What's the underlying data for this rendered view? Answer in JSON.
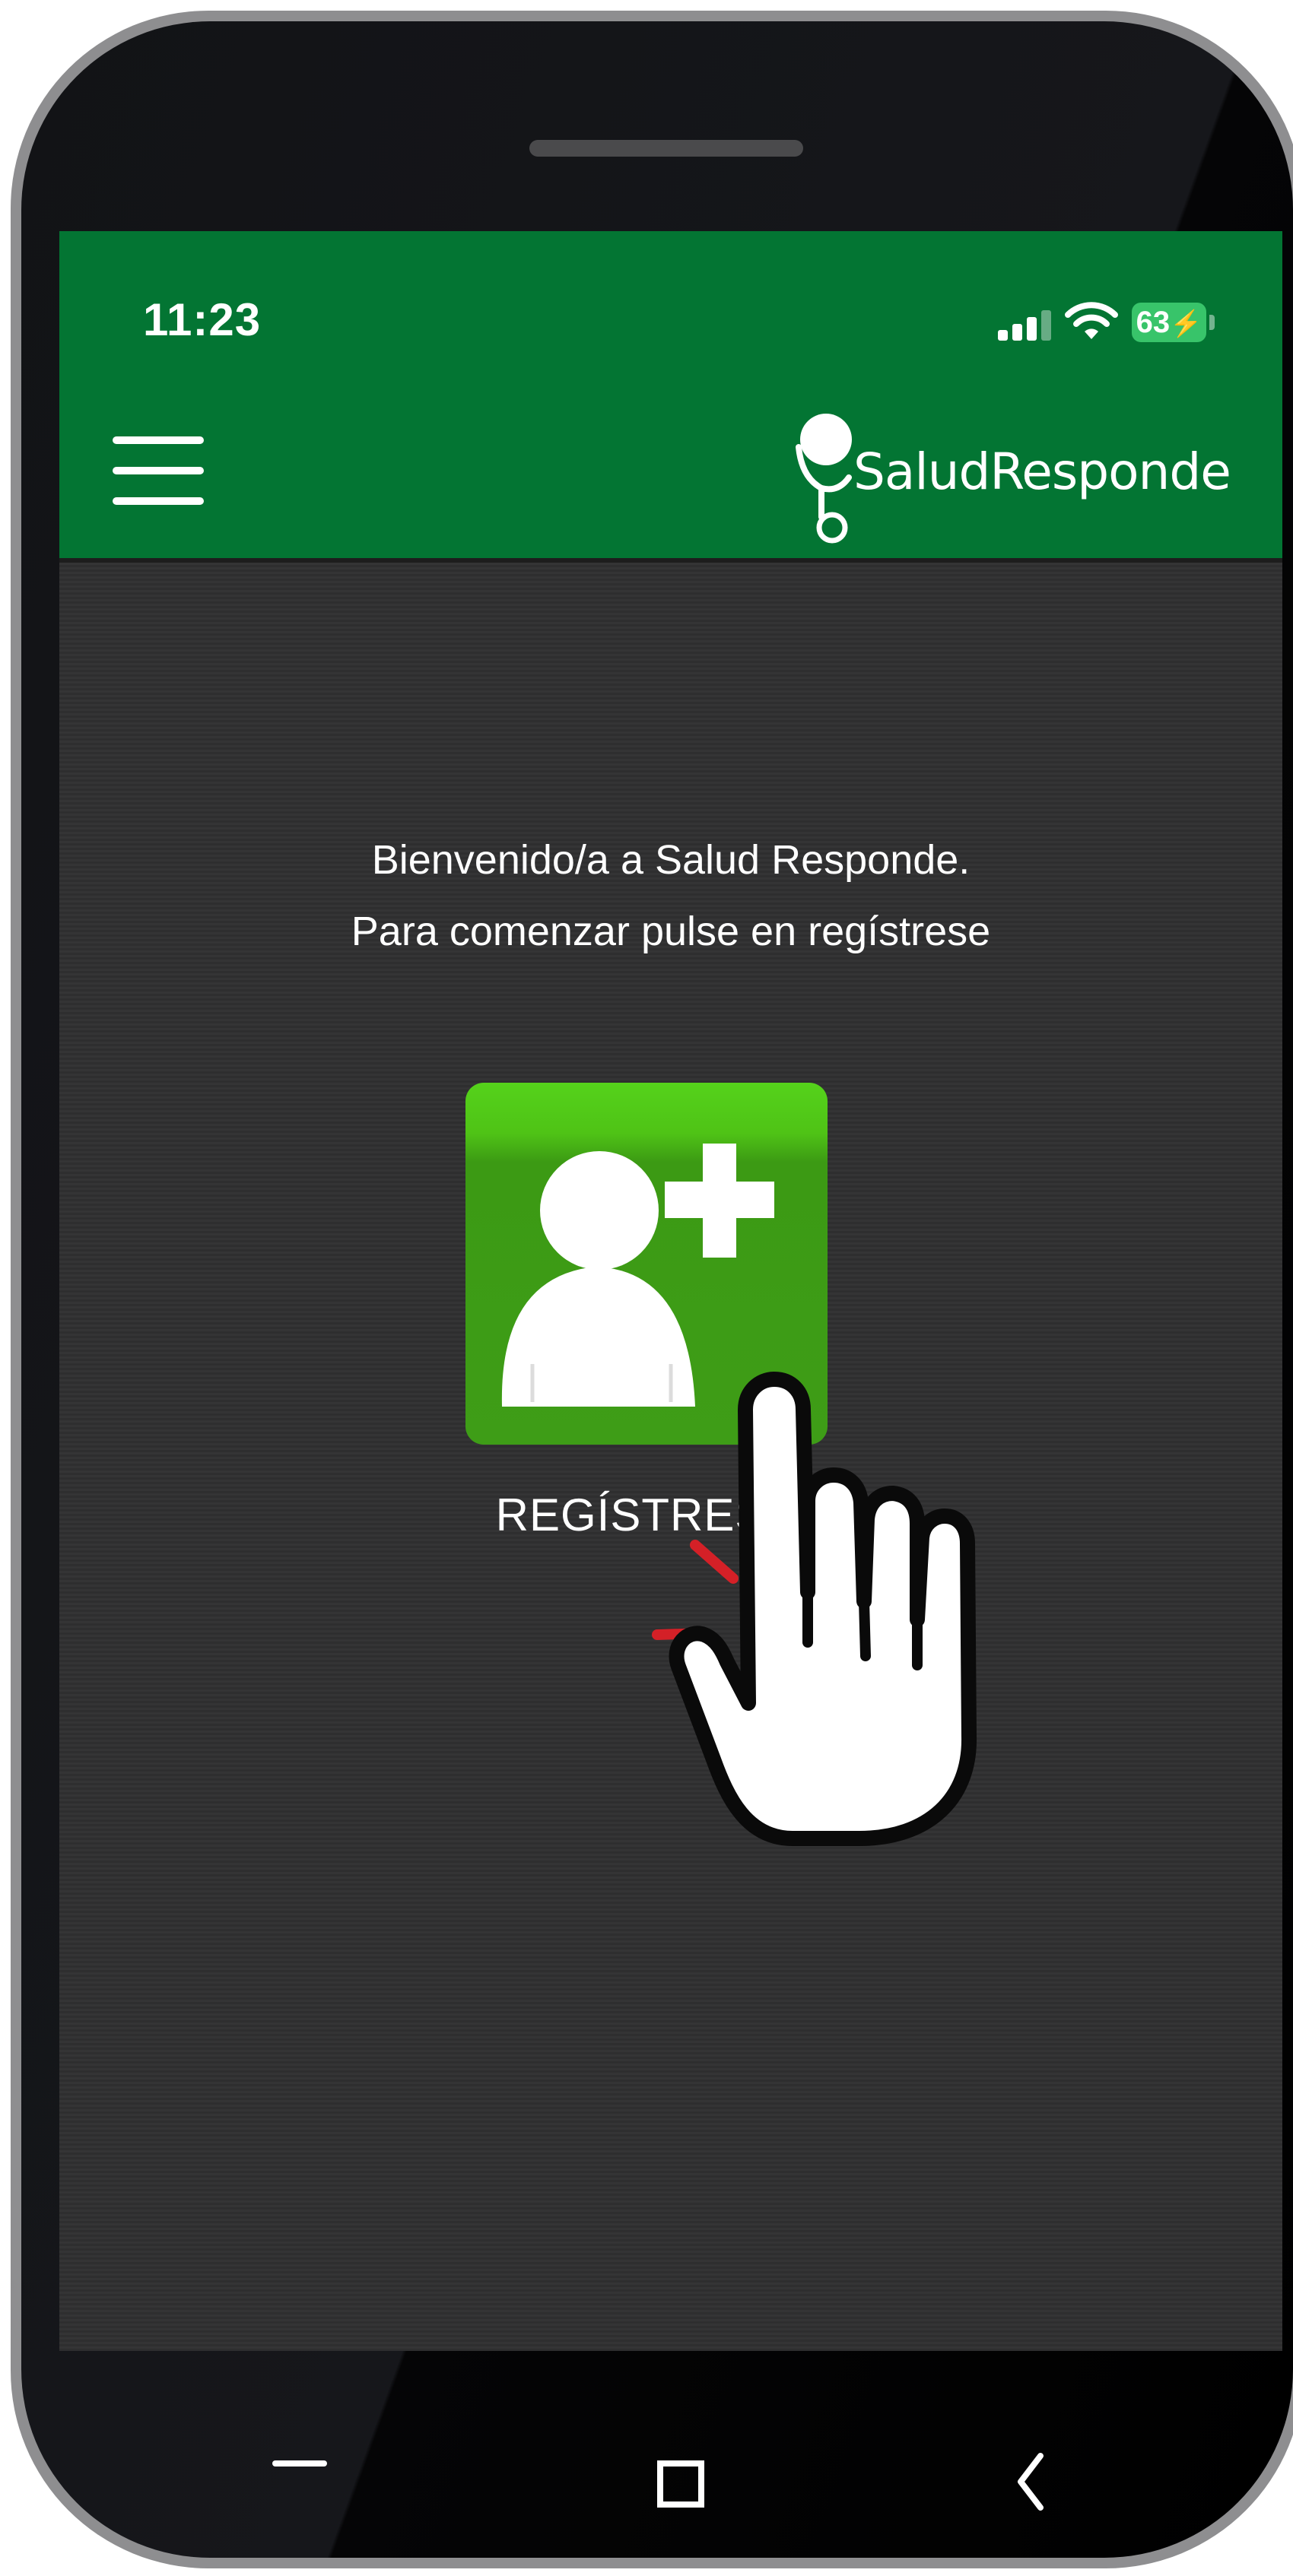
{
  "status_bar": {
    "time": "11:23",
    "battery": "63"
  },
  "app": {
    "logo_text": "SaludResponde",
    "brand_color": "#037533",
    "accent_color": "#4fc316"
  },
  "welcome": {
    "line1": "Bienvenido/a a Salud Responde.",
    "line2": "Para comenzar pulse en regístrese"
  },
  "register": {
    "label": "REGÍSTRESE",
    "icon": "add-user-icon"
  },
  "overlay": {
    "icon": "tap-hand-icon",
    "highlight_color": "#d42027"
  },
  "nav": {
    "recents_icon": "recents-icon",
    "home_icon": "home-icon",
    "back_icon": "back-icon"
  }
}
